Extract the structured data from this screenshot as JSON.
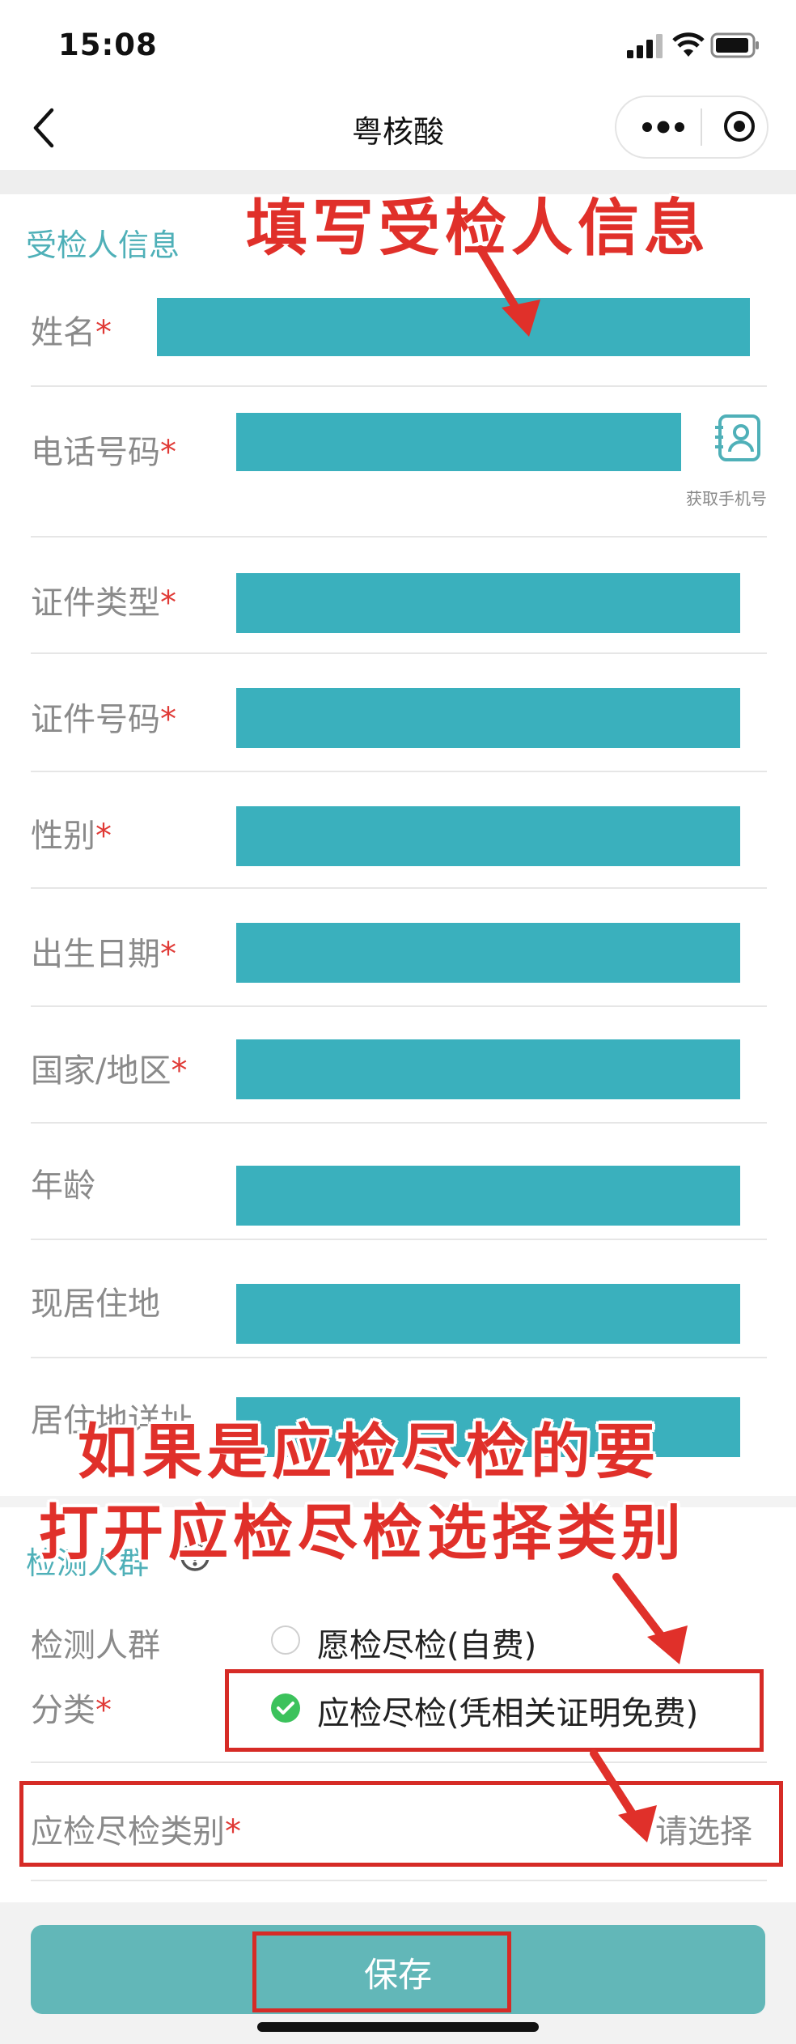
{
  "status_bar": {
    "time": "15:08"
  },
  "nav": {
    "title": "粤核酸"
  },
  "section1": {
    "title": "受检人信息"
  },
  "fields": [
    {
      "label": "姓名",
      "required": "*"
    },
    {
      "label": "电话号码",
      "required": "*"
    },
    {
      "label": "证件类型",
      "required": "*"
    },
    {
      "label": "证件号码",
      "required": "*"
    },
    {
      "label": "性别",
      "required": "*"
    },
    {
      "label": "出生日期",
      "required": "*"
    },
    {
      "label": "国家/地区",
      "required": "*"
    },
    {
      "label": "年龄",
      "required": ""
    },
    {
      "label": "现居住地",
      "required": ""
    },
    {
      "label": "居住地详址",
      "required": ""
    }
  ],
  "contact": {
    "label": "获取手机号"
  },
  "section2": {
    "title": "检测人群",
    "group_label_line1": "检测人群",
    "group_label_line2": "分类",
    "group_required": "*",
    "option1": "愿检尽检(自费)",
    "option2": "应检尽检(凭相关证明免费)",
    "category_label": "应检尽检类别",
    "category_required": "*",
    "category_placeholder": "请选择"
  },
  "save": {
    "label": "保存"
  },
  "annotations": {
    "top": "填写受检人信息",
    "bottom_line1": "如果是应检尽检的要",
    "bottom_line2": "打开应检尽检选择类别"
  },
  "colors": {
    "accent": "#4fb0b8",
    "field_fill": "#3ab0bd",
    "required": "#e03a36",
    "annotation": "#e0302a",
    "radio_checked": "#3cc25c"
  }
}
